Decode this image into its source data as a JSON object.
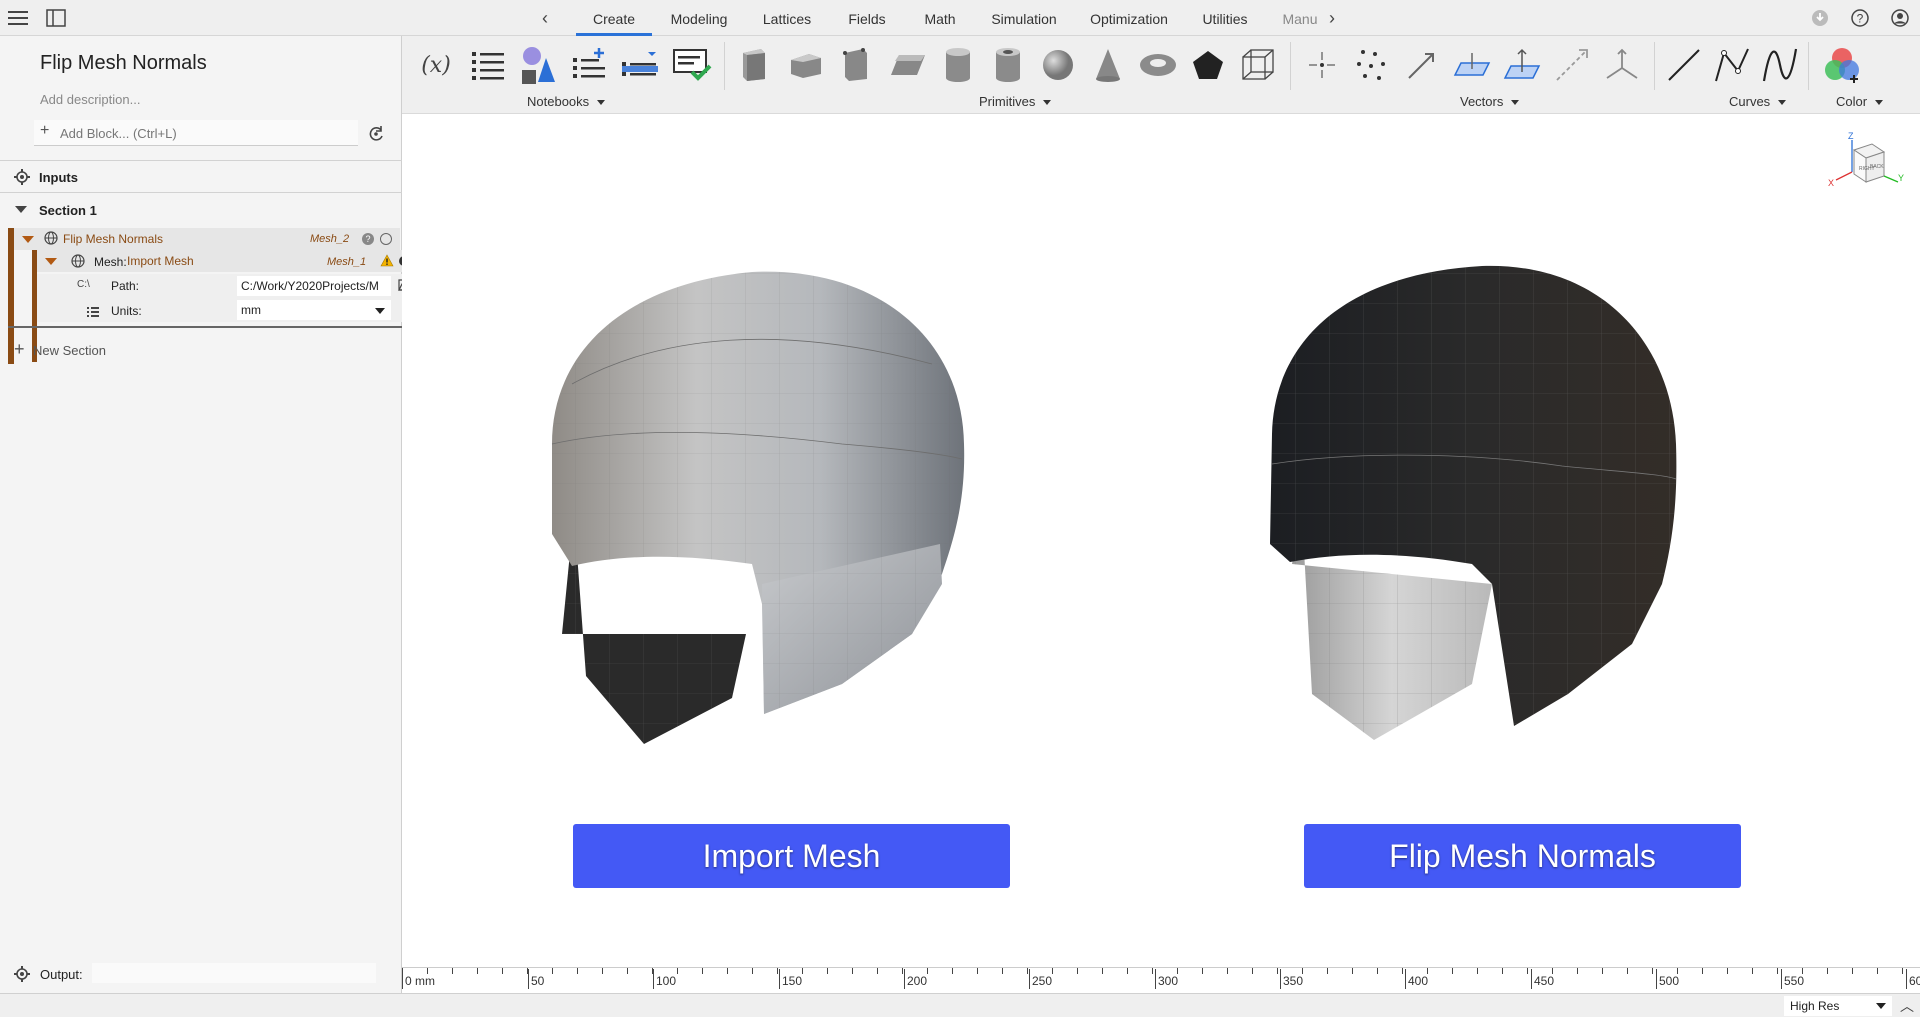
{
  "topbar": {
    "tabs": [
      "Create",
      "Modeling",
      "Lattices",
      "Fields",
      "Math",
      "Simulation",
      "Optimization",
      "Utilities",
      "Manu"
    ],
    "active_tab": "Create"
  },
  "left": {
    "title": "Flip Mesh Normals",
    "description_placeholder": "Add description...",
    "add_block_placeholder": "Add Block... (Ctrl+L)",
    "inputs_label": "Inputs",
    "section_label": "Section 1",
    "block": {
      "name": "Flip Mesh Normals",
      "output": "Mesh_2",
      "mesh_label": "Mesh:",
      "mesh_source": "Import Mesh",
      "mesh_output": "Mesh_1",
      "path_prefix": "C:\\",
      "path_label": "Path:",
      "path_value": "C:/Work/Y2020Projects/M",
      "units_label": "Units:",
      "units_value": "mm"
    },
    "new_section": "New Section",
    "output_label": "Output:"
  },
  "ribbon": {
    "groups": [
      "Notebooks",
      "Primitives",
      "Vectors",
      "Curves",
      "Color"
    ]
  },
  "viewport": {
    "left_button": "Import Mesh",
    "right_button": "Flip Mesh Normals",
    "cube": {
      "z": "Z",
      "x": "X",
      "y": "Y",
      "face1": "RIGHT",
      "face2": "BACK"
    }
  },
  "ruler": {
    "labels": [
      "0 mm",
      "50",
      "100",
      "150",
      "200",
      "250",
      "300",
      "350",
      "400",
      "450",
      "500",
      "550",
      "60"
    ]
  },
  "status": {
    "quality": "High Res"
  },
  "colors": {
    "accent": "#2a72d8",
    "button": "#4459f5",
    "block": "#8a4b14"
  }
}
